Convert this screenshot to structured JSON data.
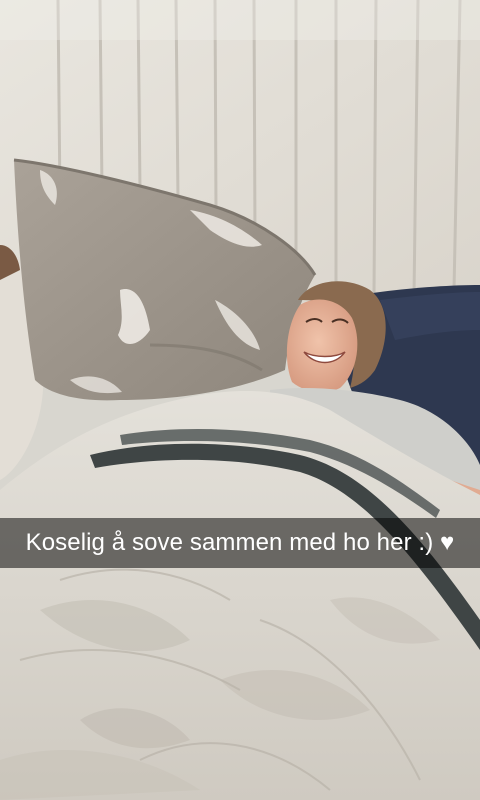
{
  "snap": {
    "caption": "Koselig å sove sammen med ho her :) ♥"
  },
  "photo": {
    "subject": "girl-smiling-in-bed",
    "palette": {
      "wall": "#e6e3dd",
      "wall_groove": "#c9c5bd",
      "pillow_grey": "#9d958c",
      "navy_pillow": "#2e3850",
      "duvet": "#dcd8d0",
      "stripe": "#3f4545",
      "skin": "#e7b59c",
      "hair": "#8a6a4f",
      "shirt": "#cfcfcb"
    }
  }
}
